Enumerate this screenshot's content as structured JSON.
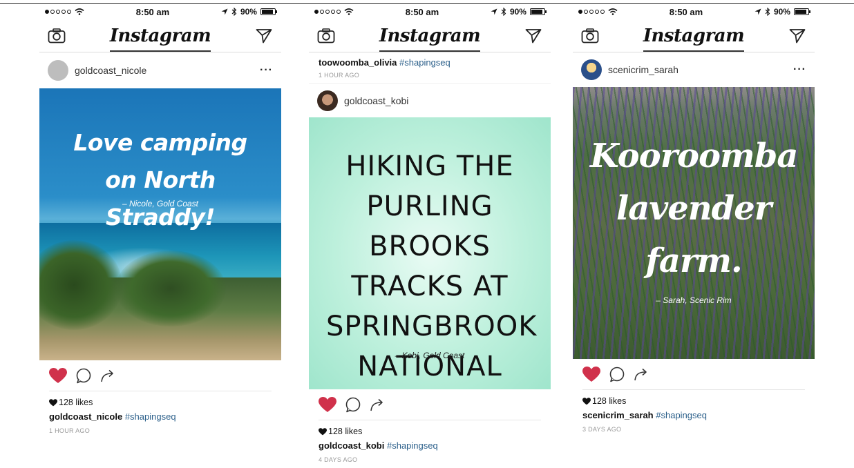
{
  "status": {
    "time": "8:50 am",
    "battery": "90%"
  },
  "app": {
    "brand": "Instagram"
  },
  "phones": [
    {
      "post": {
        "username": "goldcoast_nicole",
        "more": "···",
        "headline": "Love camping on North Straddy!",
        "byline": "– Nicole, Gold Coast",
        "likes": "128 likes",
        "caption_user": "goldcoast_nicole",
        "caption_tag": "#shapingseq",
        "time_ago": "1 HOUR AGO"
      }
    },
    {
      "prev": {
        "caption_user": "toowoomba_olivia",
        "caption_tag": "#shapingseq",
        "time_ago": "1 HOUR AGO"
      },
      "post": {
        "username": "goldcoast_kobi",
        "headline": "HIKING THE PURLING BROOKS TRACKS AT SPRINGBROOK NATIONAL PARK.",
        "byline": "– Kobi, Gold Coast",
        "likes": "128 likes",
        "caption_user": "goldcoast_kobi",
        "caption_tag": "#shapingseq",
        "time_ago": "4 DAYS AGO"
      }
    },
    {
      "post": {
        "username": "scenicrim_sarah",
        "more": "···",
        "headline": "Kooroomba lavender farm.",
        "byline": "– Sarah, Scenic Rim",
        "likes": "128 likes",
        "caption_user": "scenicrim_sarah",
        "caption_tag": "#shapingseq",
        "time_ago": "3 DAYS AGO"
      }
    }
  ],
  "colors": {
    "heart": "#d0314b",
    "hashtag": "#2b5f8a",
    "mint": "#bdf0dc"
  },
  "icons": [
    "camera-icon",
    "send-icon",
    "heart-icon",
    "comment-icon",
    "share-icon",
    "wifi-icon",
    "location-icon",
    "bluetooth-icon",
    "battery-icon"
  ]
}
